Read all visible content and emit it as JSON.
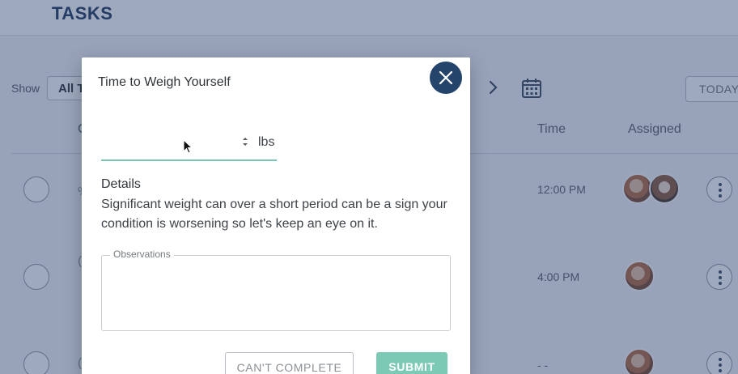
{
  "page": {
    "title": "TASKS",
    "show_label": "Show",
    "show_value": "All T",
    "today_label": "TODAY",
    "columns": {
      "c": "C",
      "time": "Time",
      "assigned": "Assigned"
    },
    "rows": [
      {
        "time": "12:00 PM",
        "frag": "%"
      },
      {
        "time": "4:00 PM",
        "frag": "("
      },
      {
        "time": "- -",
        "frag": "("
      }
    ]
  },
  "modal": {
    "title": "Time to Weigh Yourself",
    "weight_value": "",
    "weight_unit": "lbs",
    "details_label": "Details",
    "details_text": "Significant weight can over a short period can be a sign your condition is worsening so let's keep an eye on it.",
    "observations_label": "Observations",
    "observations_value": "",
    "cant_complete_label": "CAN'T COMPLETE",
    "submit_label": "SUBMIT"
  },
  "colors": {
    "brand_navy": "#24446b",
    "accent_teal": "#7cc9b6",
    "overlay": "rgba(40, 64, 110, 0.45)"
  },
  "icons": [
    "close-icon",
    "calendar-icon",
    "chevron-right-icon",
    "spinner-icon",
    "more-vertical-icon",
    "cursor-icon"
  ]
}
